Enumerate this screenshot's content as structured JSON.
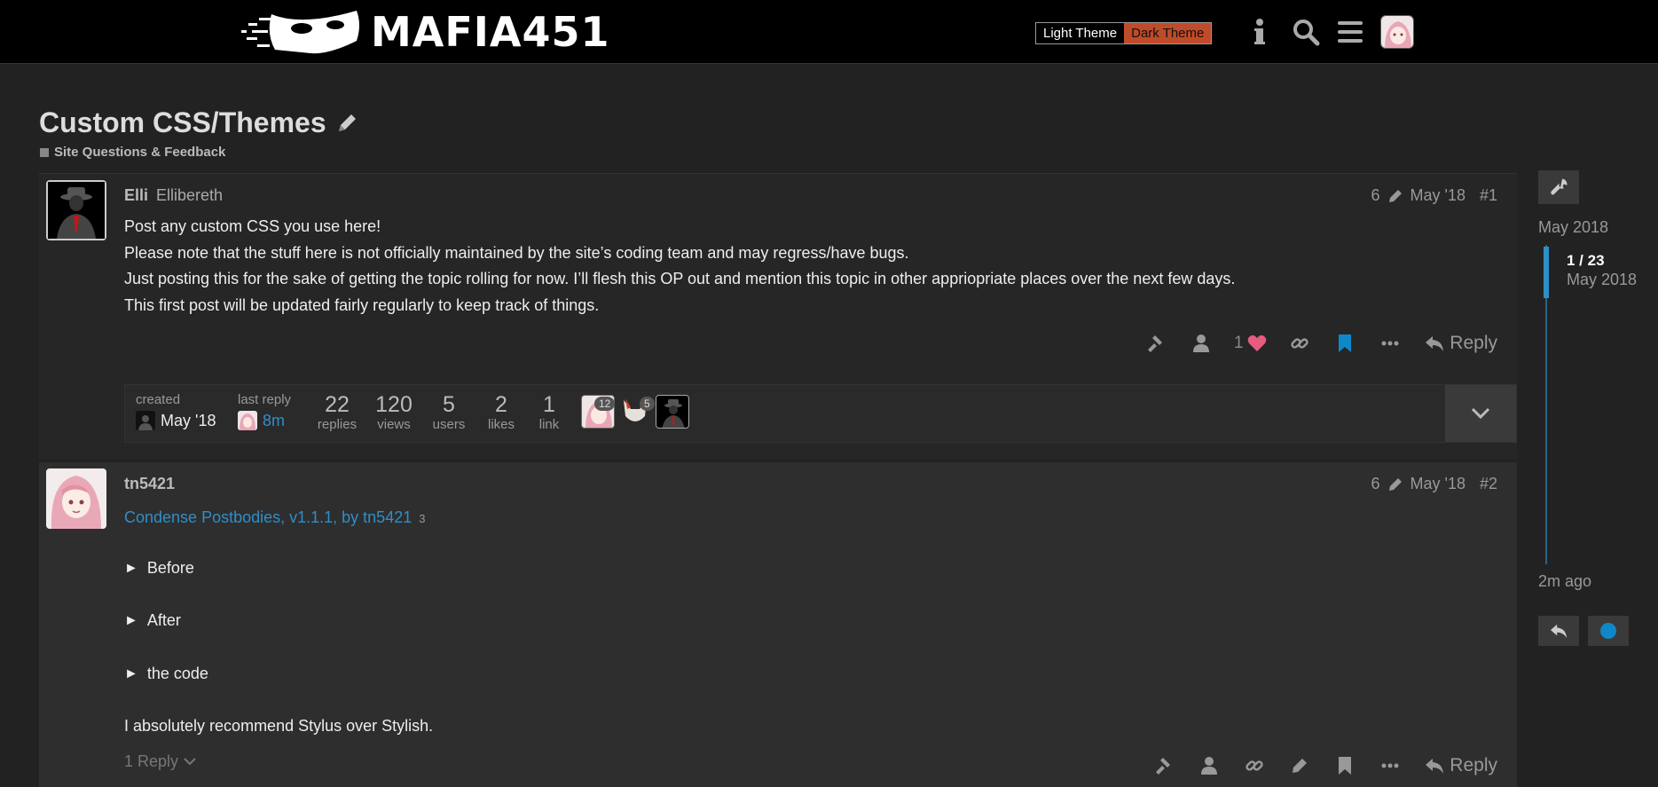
{
  "header": {
    "logo_text": "MAFIA451",
    "theme_light_label": "Light Theme",
    "theme_dark_label": "Dark Theme"
  },
  "topic": {
    "title": "Custom CSS/Themes",
    "category": "Site Questions & Feedback"
  },
  "posts": [
    {
      "username": "Elli",
      "full_name": "Ellibereth",
      "edits": "6",
      "date": "May '18",
      "number": "#1",
      "body": [
        "Post any custom CSS you use here!",
        "Please note that the stuff here is not officially maintained by the site’s coding team and may regress/have bugs.",
        "Just posting this for the sake of getting the topic rolling for now. I’ll flesh this OP out and mention this topic in other appriopriate places over the next few days.",
        "This first post will be updated fairly regularly to keep track of things."
      ],
      "like_count": "1",
      "reply_label": "Reply"
    },
    {
      "username": "tn5421",
      "edits": "6",
      "date": "May '18",
      "number": "#2",
      "link_title": "Condense Postbodies, v1.1.1, by tn5421",
      "link_clicks": "3",
      "details": [
        "Before",
        "After",
        "the code"
      ],
      "closing": "I absolutely recommend Stylus over Stylish.",
      "replies_toggle": "1 Reply",
      "reply_label": "Reply"
    }
  ],
  "topic_map": {
    "created_label": "created",
    "created_date": "May '18",
    "last_reply_label": "last reply",
    "last_reply_age": "8m",
    "stats": [
      {
        "num": "22",
        "label": "replies"
      },
      {
        "num": "120",
        "label": "views"
      },
      {
        "num": "5",
        "label": "users"
      },
      {
        "num": "2",
        "label": "likes"
      },
      {
        "num": "1",
        "label": "link"
      }
    ],
    "participant_badges": [
      "12",
      "5"
    ]
  },
  "timeline": {
    "start_date": "May 2018",
    "position": "1 / 23",
    "position_date": "May 2018",
    "end_label": "2m ago"
  },
  "colors": {
    "accent": "#2e8fc9",
    "dark_theme_button": "#c04b2a",
    "heart": "#e45c7e",
    "bookmark": "#0e88c9"
  }
}
